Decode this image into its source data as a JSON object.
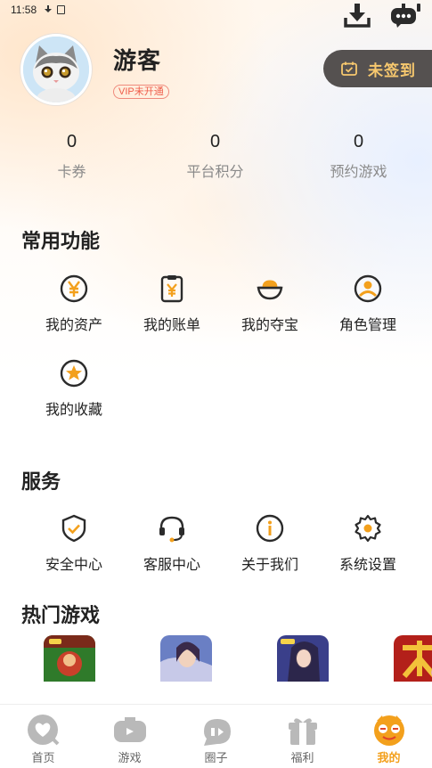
{
  "status_bar": {
    "time": "11:58"
  },
  "top_bar": {
    "download_icon": "download-icon",
    "service_icon": "robot-chat-icon"
  },
  "profile": {
    "nickname": "游客",
    "vip_status": "VIP未开通",
    "signin_label": "未签到",
    "avatar": "kitten-avatar"
  },
  "stats": [
    {
      "value": "0",
      "label": "卡券"
    },
    {
      "value": "0",
      "label": "平台积分"
    },
    {
      "value": "0",
      "label": "预约游戏"
    }
  ],
  "common_functions": {
    "title": "常用功能",
    "items": [
      {
        "label": "我的资产",
        "icon": "yen-coin-icon"
      },
      {
        "label": "我的账单",
        "icon": "bill-icon"
      },
      {
        "label": "我的夺宝",
        "icon": "treasure-icon"
      },
      {
        "label": "角色管理",
        "icon": "user-circle-icon"
      },
      {
        "label": "我的收藏",
        "icon": "star-icon"
      }
    ]
  },
  "services": {
    "title": "服务",
    "items": [
      {
        "label": "安全中心",
        "icon": "shield-check-icon"
      },
      {
        "label": "客服中心",
        "icon": "headset-icon"
      },
      {
        "label": "关于我们",
        "icon": "info-icon"
      },
      {
        "label": "系统设置",
        "icon": "gear-icon"
      }
    ]
  },
  "hot_games": {
    "title": "热门游戏"
  },
  "tabs": [
    {
      "label": "首页",
      "icon": "home-heart-icon",
      "active": false
    },
    {
      "label": "游戏",
      "icon": "gamepad-icon",
      "active": false
    },
    {
      "label": "圈子",
      "icon": "chat-bubble-icon",
      "active": false
    },
    {
      "label": "福利",
      "icon": "gift-icon",
      "active": false
    },
    {
      "label": "我的",
      "icon": "mine-face-icon",
      "active": true
    }
  ],
  "colors": {
    "accent": "#f3a01c",
    "vip": "#ef5d4a",
    "signin_bg": "#555150",
    "signin_text": "#f7c86e"
  }
}
